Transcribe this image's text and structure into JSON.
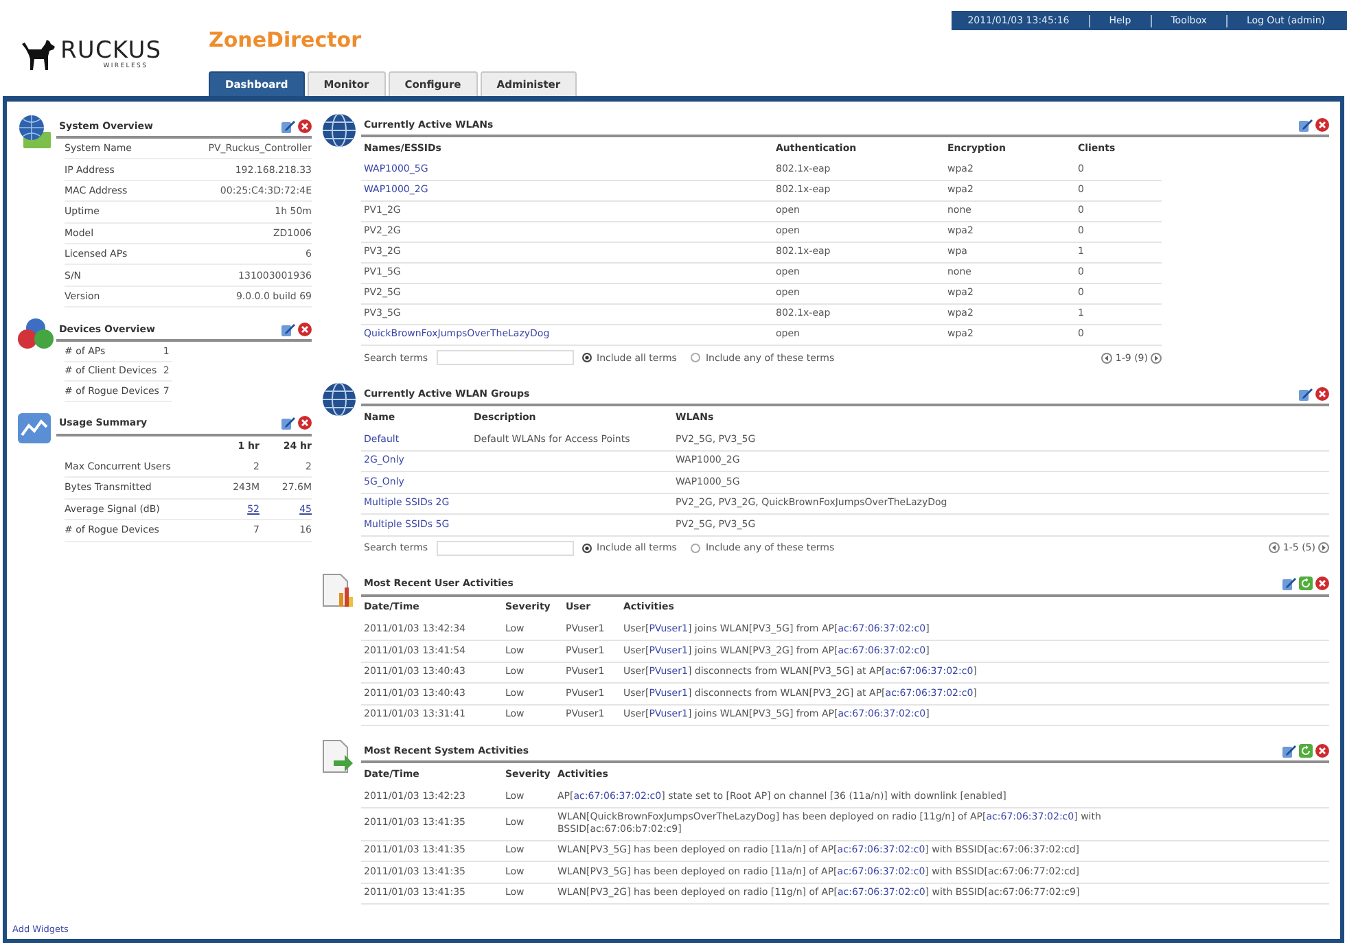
{
  "header": {
    "brand": "RUCKUS",
    "tagline": "WIRELESS",
    "product": "ZoneDirector"
  },
  "top_bar": {
    "datetime": "2011/01/03 13:45:16",
    "links": [
      "Help",
      "Toolbox",
      "Log Out (admin)"
    ]
  },
  "tabs": [
    {
      "label": "Dashboard",
      "selected": true
    },
    {
      "label": "Monitor",
      "selected": false
    },
    {
      "label": "Configure",
      "selected": false
    },
    {
      "label": "Administer",
      "selected": false
    }
  ],
  "left_widgets": [
    {
      "kind": "system_overview",
      "title": "System Overview",
      "rows": [
        {
          "label": "System Name",
          "value": "PV_Ruckus_Controller"
        },
        {
          "label": "IP Address",
          "value": "192.168.218.33"
        },
        {
          "label": "MAC Address",
          "value": "00:25:C4:3D:72:4E"
        },
        {
          "label": "Uptime",
          "value": "1h 50m"
        },
        {
          "label": "Model",
          "value": "ZD1006"
        },
        {
          "label": "Licensed APs",
          "value": "6"
        },
        {
          "label": "S/N",
          "value": "131003001936"
        },
        {
          "label": "Version",
          "value": "9.0.0.0 build 69"
        }
      ]
    },
    {
      "kind": "devices_overview",
      "title": "Devices Overview",
      "rows": [
        {
          "label": "# of APs",
          "value": "1"
        },
        {
          "label": "# of Client Devices",
          "value": "2"
        },
        {
          "label": "# of Rogue Devices",
          "value": "7"
        }
      ]
    },
    {
      "kind": "usage_summary",
      "title": "Usage Summary",
      "columns": [
        "1 hr",
        "24 hr"
      ],
      "rows": [
        {
          "label": "Max Concurrent Users",
          "values": [
            "2",
            "2"
          ],
          "linked": false
        },
        {
          "label": "Bytes Transmitted",
          "values": [
            "243M",
            "27.6M"
          ],
          "linked": false
        },
        {
          "label": "Average Signal (dB)",
          "values": [
            "52",
            "45"
          ],
          "linked": true
        },
        {
          "label": "# of Rogue Devices",
          "values": [
            "7",
            "16"
          ],
          "linked": false
        }
      ]
    }
  ],
  "add_widgets": "Add Widgets",
  "right_widgets": [
    {
      "kind": "wlans",
      "title": "Currently Active WLANs",
      "columns": [
        "Names/ESSIDs",
        "Authentication",
        "Encryption",
        "Clients"
      ],
      "rows": [
        {
          "name": "WAP1000_5G",
          "linked": true,
          "authentication": "802.1x-eap",
          "encryption": "wpa2",
          "clients": "0"
        },
        {
          "name": "WAP1000_2G",
          "linked": true,
          "authentication": "802.1x-eap",
          "encryption": "wpa2",
          "clients": "0"
        },
        {
          "name": "PV1_2G",
          "linked": false,
          "authentication": "open",
          "encryption": "none",
          "clients": "0"
        },
        {
          "name": "PV2_2G",
          "linked": false,
          "authentication": "open",
          "encryption": "wpa2",
          "clients": "0"
        },
        {
          "name": "PV3_2G",
          "linked": false,
          "authentication": "802.1x-eap",
          "encryption": "wpa",
          "clients": "1"
        },
        {
          "name": "PV1_5G",
          "linked": false,
          "authentication": "open",
          "encryption": "none",
          "clients": "0"
        },
        {
          "name": "PV2_5G",
          "linked": false,
          "authentication": "open",
          "encryption": "wpa2",
          "clients": "0"
        },
        {
          "name": "PV3_5G",
          "linked": false,
          "authentication": "802.1x-eap",
          "encryption": "wpa2",
          "clients": "1"
        },
        {
          "name": "QuickBrownFoxJumpsOverTheLazyDog",
          "linked": true,
          "authentication": "open",
          "encryption": "wpa2",
          "clients": "0"
        }
      ],
      "search": {
        "label": "Search terms",
        "options": [
          {
            "label": "Include all terms",
            "selected": true
          },
          {
            "label": "Include any of these terms",
            "selected": false
          }
        ],
        "pager": "1-9 (9)"
      }
    },
    {
      "kind": "wlan_groups",
      "title": "Currently Active WLAN Groups",
      "columns": [
        "Name",
        "Description",
        "WLANs"
      ],
      "rows": [
        {
          "name": "Default",
          "description": "Default WLANs for Access Points",
          "wlans": "PV2_5G, PV3_5G"
        },
        {
          "name": "2G_Only",
          "wlans": "WAP1000_2G"
        },
        {
          "name": "5G_Only",
          "wlans": "WAP1000_5G"
        },
        {
          "name": "Multiple SSIDs 2G",
          "wlans": "PV2_2G, PV3_2G, QuickBrownFoxJumpsOverTheLazyDog"
        },
        {
          "name": "Multiple SSIDs 5G",
          "wlans": "PV2_5G, PV3_5G"
        }
      ],
      "search": {
        "label": "Search terms",
        "options": [
          {
            "label": "Include all terms",
            "selected": true
          },
          {
            "label": "Include any of these terms",
            "selected": false
          }
        ],
        "pager": "1-5 (5)"
      }
    },
    {
      "kind": "user_activities",
      "title": "Most Recent User Activities",
      "columns": [
        "Date/Time",
        "Severity",
        "User",
        "Activities"
      ],
      "rows": [
        {
          "datetime": "2011/01/03 13:42:34",
          "severity": "Low",
          "user": "PVuser1",
          "activity": [
            {
              "kind": "text",
              "text": "User["
            },
            {
              "kind": "link",
              "text": "PVuser1"
            },
            {
              "kind": "text",
              "text": "] joins WLAN[PV3_5G] from AP["
            },
            {
              "kind": "link",
              "text": "ac:67:06:37:02:c0"
            },
            {
              "kind": "text",
              "text": "]"
            }
          ]
        },
        {
          "datetime": "2011/01/03 13:41:54",
          "severity": "Low",
          "user": "PVuser1",
          "activity": [
            {
              "kind": "text",
              "text": "User["
            },
            {
              "kind": "link",
              "text": "PVuser1"
            },
            {
              "kind": "text",
              "text": "] joins WLAN[PV3_2G] from AP["
            },
            {
              "kind": "link",
              "text": "ac:67:06:37:02:c0"
            },
            {
              "kind": "text",
              "text": "]"
            }
          ]
        },
        {
          "datetime": "2011/01/03 13:40:43",
          "severity": "Low",
          "user": "PVuser1",
          "activity": [
            {
              "kind": "text",
              "text": "User["
            },
            {
              "kind": "link",
              "text": "PVuser1"
            },
            {
              "kind": "text",
              "text": "] disconnects from WLAN[PV3_5G] at AP["
            },
            {
              "kind": "link",
              "text": "ac:67:06:37:02:c0"
            },
            {
              "kind": "text",
              "text": "]"
            }
          ]
        },
        {
          "datetime": "2011/01/03 13:40:43",
          "severity": "Low",
          "user": "PVuser1",
          "activity": [
            {
              "kind": "text",
              "text": "User["
            },
            {
              "kind": "link",
              "text": "PVuser1"
            },
            {
              "kind": "text",
              "text": "] disconnects from WLAN[PV3_2G] at AP["
            },
            {
              "kind": "link",
              "text": "ac:67:06:37:02:c0"
            },
            {
              "kind": "text",
              "text": "]"
            }
          ]
        },
        {
          "datetime": "2011/01/03 13:31:41",
          "severity": "Low",
          "user": "PVuser1",
          "activity": [
            {
              "kind": "text",
              "text": "User["
            },
            {
              "kind": "link",
              "text": "PVuser1"
            },
            {
              "kind": "text",
              "text": "] joins WLAN[PV3_5G] from AP["
            },
            {
              "kind": "link",
              "text": "ac:67:06:37:02:c0"
            },
            {
              "kind": "text",
              "text": "]"
            }
          ]
        }
      ]
    },
    {
      "kind": "system_activities",
      "title": "Most Recent System Activities",
      "columns": [
        "Date/Time",
        "Severity",
        "Activities"
      ],
      "rows": [
        {
          "datetime": "2011/01/03 13:42:23",
          "severity": "Low",
          "activity": [
            {
              "kind": "text",
              "text": "AP["
            },
            {
              "kind": "link",
              "text": "ac:67:06:37:02:c0"
            },
            {
              "kind": "text",
              "text": "] state set to [Root AP] on channel [36 (11a/n)] with downlink [enabled]"
            }
          ]
        },
        {
          "datetime": "2011/01/03 13:41:35",
          "severity": "Low",
          "activity": [
            {
              "kind": "text",
              "text": "WLAN[QuickBrownFoxJumpsOverTheLazyDog] has been deployed on radio [11g/n] of AP["
            },
            {
              "kind": "link",
              "text": "ac:67:06:37:02:c0"
            },
            {
              "kind": "text",
              "text": "] with BSSID[ac:67:06:b7:02:c9]"
            }
          ]
        },
        {
          "datetime": "2011/01/03 13:41:35",
          "severity": "Low",
          "activity": [
            {
              "kind": "text",
              "text": "WLAN[PV3_5G] has been deployed on radio [11a/n] of AP["
            },
            {
              "kind": "link",
              "text": "ac:67:06:37:02:c0"
            },
            {
              "kind": "text",
              "text": "] with BSSID[ac:67:06:37:02:cd]"
            }
          ]
        },
        {
          "datetime": "2011/01/03 13:41:35",
          "severity": "Low",
          "activity": [
            {
              "kind": "text",
              "text": "WLAN[PV3_5G] has been deployed on radio [11a/n] of AP["
            },
            {
              "kind": "link",
              "text": "ac:67:06:37:02:c0"
            },
            {
              "kind": "text",
              "text": "] with BSSID[ac:67:06:77:02:cd]"
            }
          ]
        },
        {
          "datetime": "2011/01/03 13:41:35",
          "severity": "Low",
          "activity": [
            {
              "kind": "text",
              "text": "WLAN[PV3_2G] has been deployed on radio [11g/n] of AP["
            },
            {
              "kind": "link",
              "text": "ac:67:06:37:02:c0"
            },
            {
              "kind": "text",
              "text": "] with BSSID[ac:67:06:77:02:c9]"
            }
          ]
        }
      ]
    }
  ]
}
